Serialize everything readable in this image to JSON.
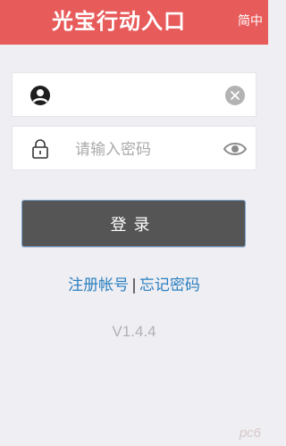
{
  "header": {
    "title": "光宝行动入口",
    "lang_toggle": "简中"
  },
  "form": {
    "username": {
      "icon": "user-icon",
      "value": "",
      "placeholder": "",
      "clear_icon": "clear-icon"
    },
    "password": {
      "icon": "lock-icon",
      "value": "",
      "placeholder": "请输入密码",
      "toggle_icon": "eye-icon"
    },
    "login_label": "登录"
  },
  "links": {
    "register": "注册帐号",
    "separator": "|",
    "forgot": "忘记密码"
  },
  "version": "V1.4.4",
  "watermark": "pc6",
  "colors": {
    "header_bg": "#e85b5b",
    "button_bg": "#555555",
    "link": "#2b7fbf",
    "background": "#eeeef3"
  }
}
